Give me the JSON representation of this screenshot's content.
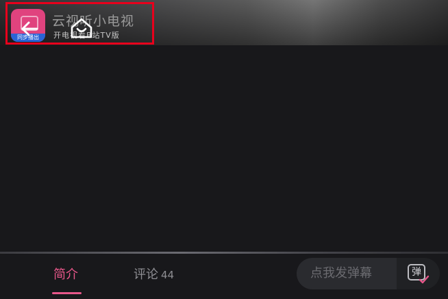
{
  "banner": {
    "title": "云视听小电视",
    "subtitle": "开电视看B站TV版",
    "logo_strip": "同步播出"
  },
  "player": {
    "back_icon": "back-arrow-icon",
    "home_icon": "home-icon"
  },
  "tabs": [
    {
      "label": "简介",
      "active": true
    },
    {
      "label": "评论",
      "count": "44",
      "active": false
    }
  ],
  "danmaku": {
    "placeholder": "点我发弹幕",
    "toggle_glyph": "弹"
  },
  "colors": {
    "accent": "#e8578a",
    "background": "#18181b",
    "highlight": "#e8001c"
  }
}
